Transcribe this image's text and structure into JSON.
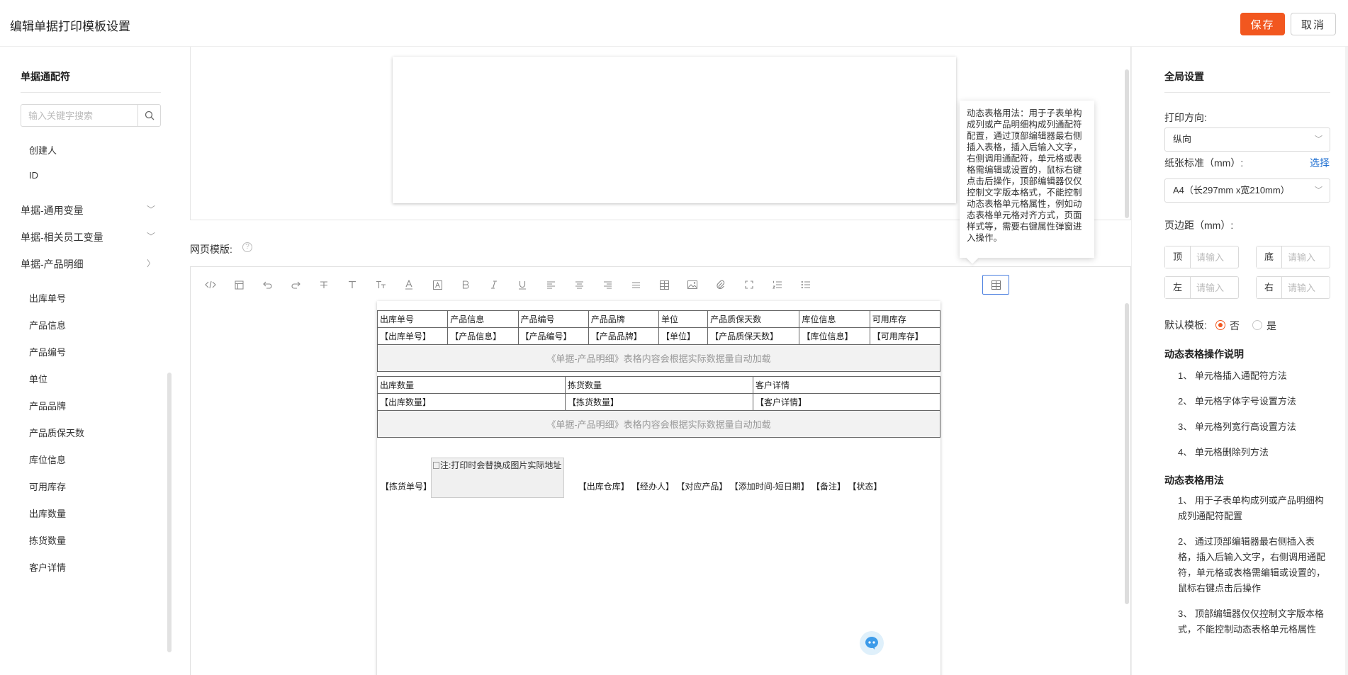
{
  "header": {
    "title": "编辑单据打印模板设置",
    "save": "保存",
    "cancel": "取消"
  },
  "left": {
    "section_title": "单据通配符",
    "search_placeholder": "输入关键字搜索",
    "top_items": [
      "创建人",
      "ID"
    ],
    "groups": [
      "单据-通用变量",
      "单据-相关员工变量",
      "单据-产品明细"
    ],
    "product_items": [
      "出库单号",
      "产品信息",
      "产品编号",
      "单位",
      "产品品牌",
      "产品质保天数",
      "库位信息",
      "可用库存",
      "出库数量",
      "拣货数量",
      "客户详情"
    ]
  },
  "center": {
    "template_label": "网页模版:",
    "toolbar_icons": [
      "code-view-icon",
      "template-icon",
      "undo-icon",
      "redo-icon",
      "strikethrough-icon",
      "heading-icon",
      "font-size-icon",
      "font-color-icon",
      "background-color-icon",
      "bold-icon",
      "italic-icon",
      "underline-icon",
      "align-left-icon",
      "align-center-icon",
      "align-right-icon",
      "justify-icon",
      "table-icon",
      "image-icon",
      "attachment-icon",
      "fullscreen-icon",
      "ordered-list-icon",
      "unordered-list-icon",
      "dynamic-table-icon"
    ],
    "table1": {
      "headers": [
        "出库单号",
        "产品信息",
        "产品编号",
        "产品品牌",
        "单位",
        "产品质保天数",
        "库位信息",
        "可用库存"
      ],
      "values": [
        "【出库单号】",
        "【产品信息】",
        "【产品编号】",
        "【产品品牌】",
        "【单位】",
        "【产品质保天数】",
        "【库位信息】",
        "【可用库存】"
      ],
      "note": "《单据-产品明细》表格内容会根据实际数据量自动加载"
    },
    "table2": {
      "headers": [
        "出库数量",
        "拣货数量",
        "客户详情"
      ],
      "values": [
        "【出库数量】",
        "【拣货数量】",
        "【客户详情】"
      ],
      "note": "《单据-产品明细》表格内容会根据实际数据量自动加载"
    },
    "image_placeholder": "注:打印时会替换成图片实际地址",
    "token_left": "【拣货单号】",
    "tokens_right": "【出库仓库】 【经办人】 【对应产品】 【添加时间-短日期】 【备注】 【状态】",
    "tooltip": "动态表格用法：用于子表单构成列或产品明细构成列通配符配置，通过顶部编辑器最右侧插入表格，插入后输入文字，右侧调用通配符，单元格或表格需编辑或设置的，鼠标右键点击后操作，顶部编辑器仅仅控制文字版本格式，不能控制动态表格单元格属性，例如动态表格单元格对齐方式，页面样式等，需要右键属性弹窗进入操作。"
  },
  "right": {
    "title": "全局设置",
    "orientation_label": "打印方向:",
    "orientation_value": "纵向",
    "paper_label": "纸张标准（mm）:",
    "paper_link": "选择",
    "paper_value": "A4（长297mm x宽210mm）",
    "margin_label": "页边距（mm）:",
    "margin_top": "顶",
    "margin_bottom": "底",
    "margin_left": "左",
    "margin_right": "右",
    "margin_placeholder": "请输入",
    "default_label": "默认模板:",
    "default_no": "否",
    "default_yes": "是",
    "ops_title": "动态表格操作说明",
    "ops": [
      "1、 单元格插入通配符方法",
      "2、 单元格字体字号设置方法",
      "3、 单元格列宽行高设置方法",
      "4、 单元格删除列方法"
    ],
    "usage_title": "动态表格用法",
    "usage": [
      "1、 用于子表单构成列或产品明细构成列通配符配置",
      "2、 通过顶部编辑器最右侧插入表格，插入后输入文字，右侧调用通配符，单元格或表格需编辑或设置的，鼠标右键点击后操作",
      "3、 顶部编辑器仅仅控制文字版本格式，不能控制动态表格单元格属性"
    ]
  }
}
